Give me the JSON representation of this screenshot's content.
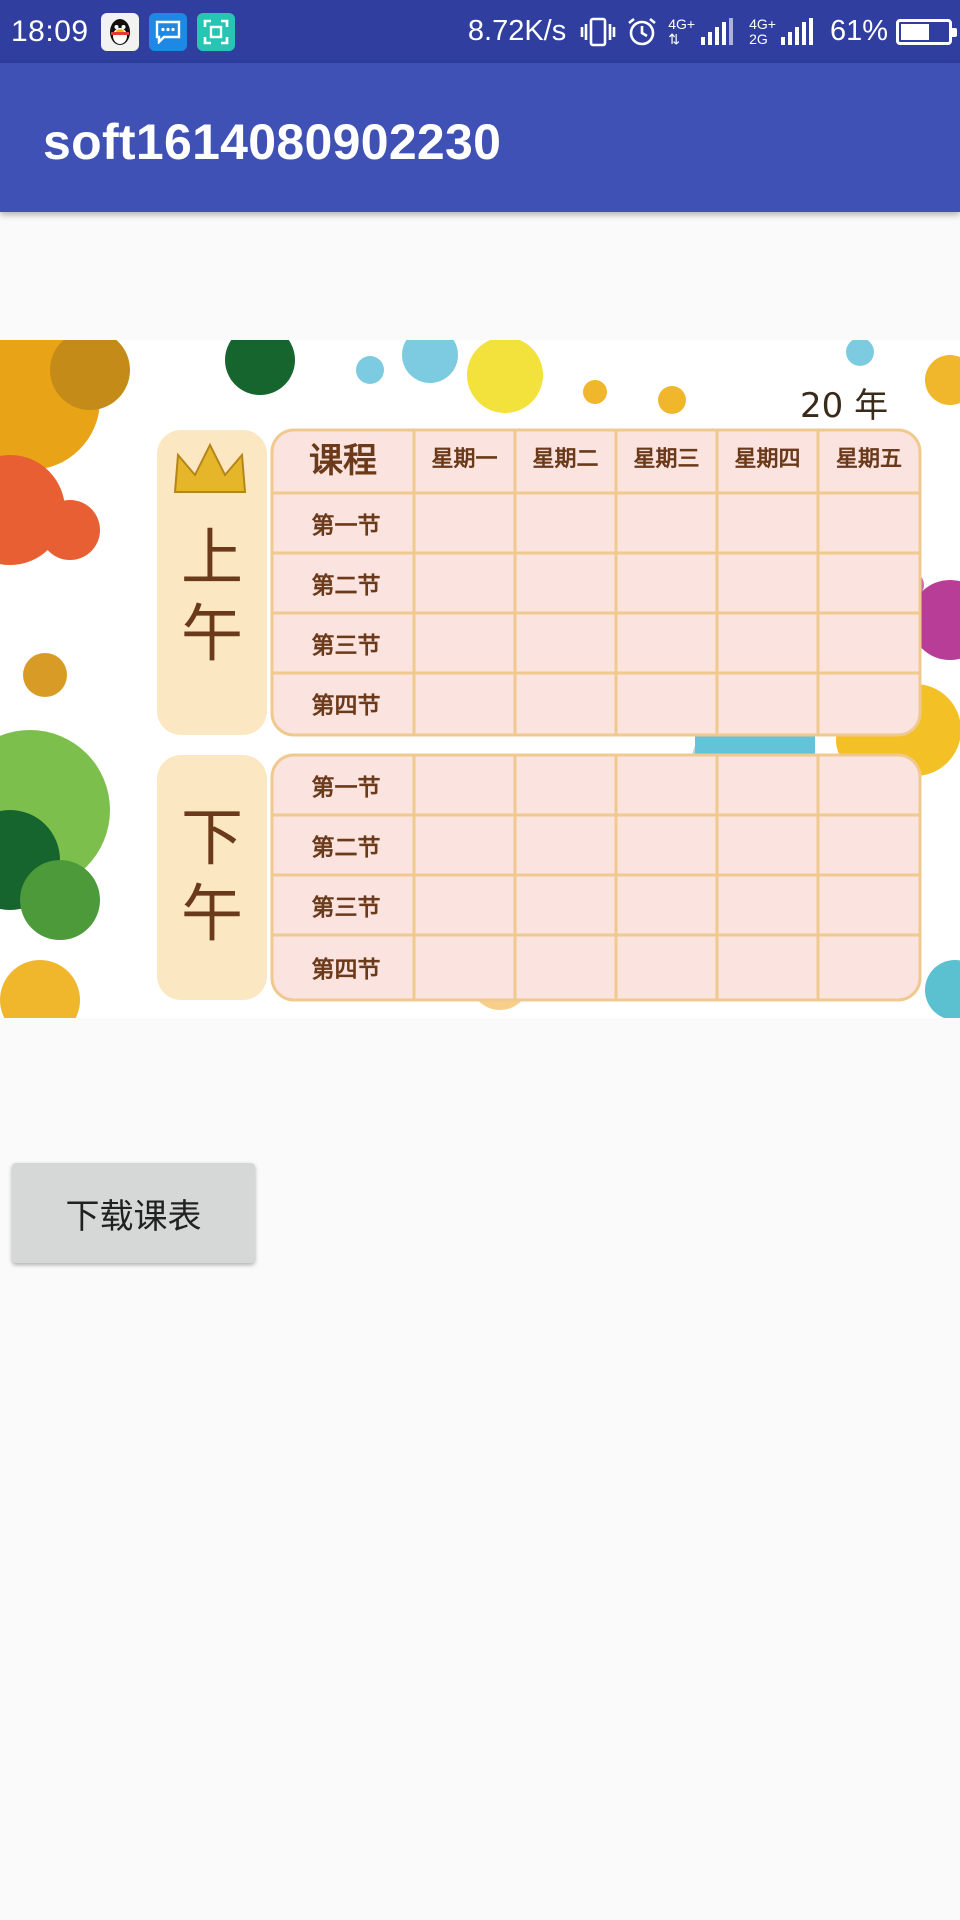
{
  "status_bar": {
    "time": "18:09",
    "notification_icons": [
      "qq-icon",
      "message-icon",
      "scan-icon"
    ],
    "net_speed": "8.72K/s",
    "net_label_top": "4G+",
    "net_label_bottom": "2G",
    "battery_percent": "61%",
    "battery_level": 0.61,
    "background_color": "#303f9f"
  },
  "app_bar": {
    "title": "soft1614080902230",
    "background_color": "#3f51b5"
  },
  "timetable": {
    "year_label": "20  年",
    "corner_label": "课程",
    "days": [
      "星期一",
      "星期二",
      "星期三",
      "星期四",
      "星期五"
    ],
    "morning_label": [
      "上",
      "午"
    ],
    "afternoon_label": [
      "下",
      "午"
    ],
    "morning_periods": [
      "第一节",
      "第二节",
      "第三节",
      "第四节"
    ],
    "afternoon_periods": [
      "第一节",
      "第二节",
      "第三节",
      "第四节"
    ]
  },
  "download_button": {
    "label": "下载课表"
  }
}
